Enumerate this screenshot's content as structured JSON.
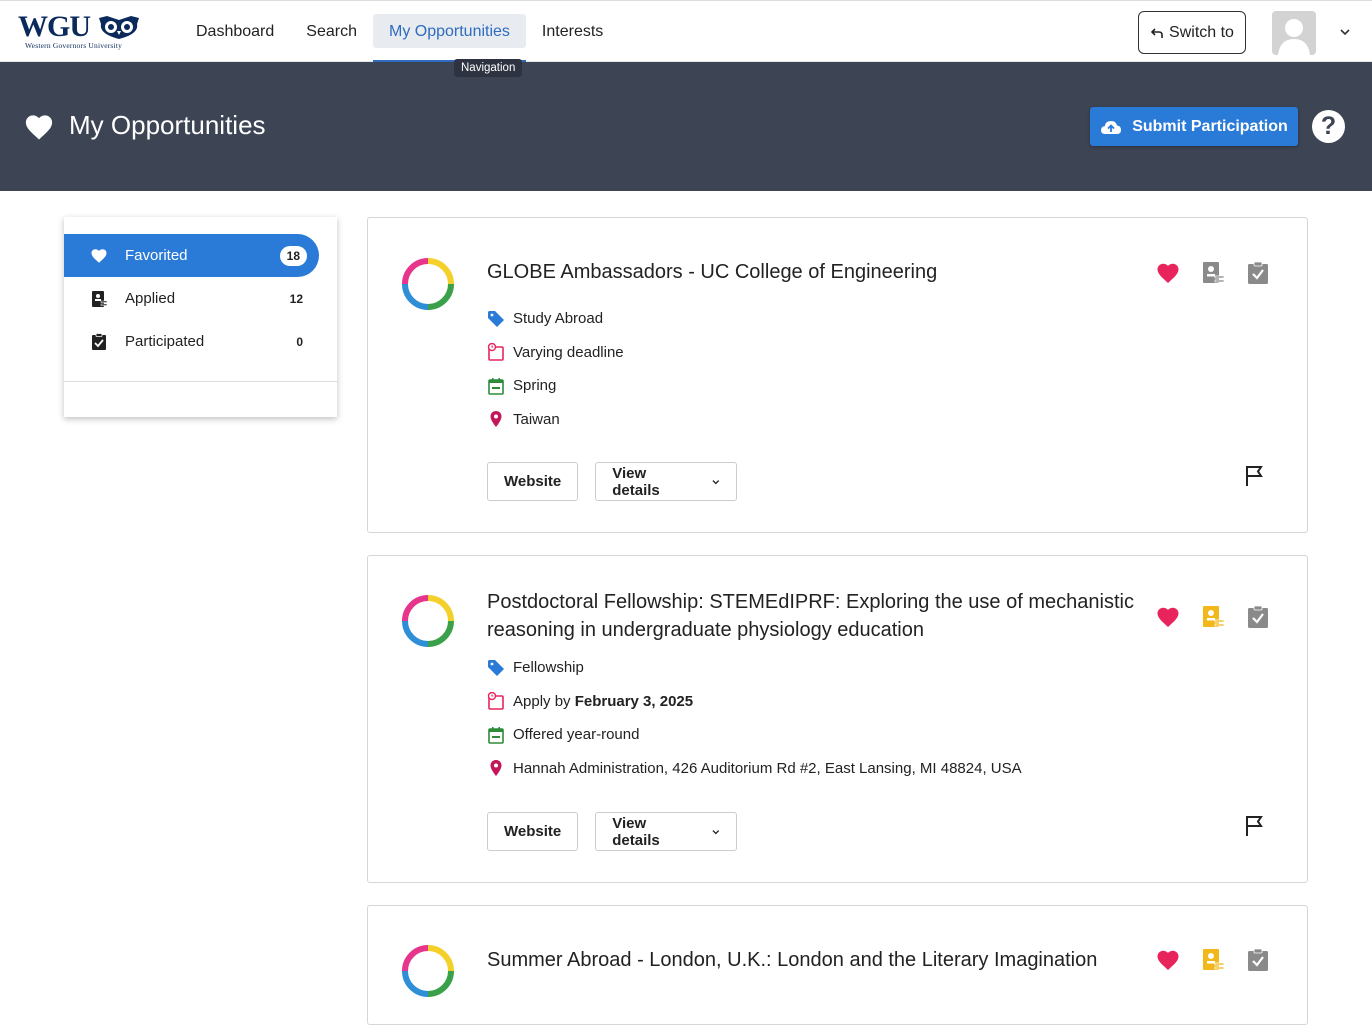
{
  "brand": {
    "logo_text": "WGU",
    "logo_subtitle": "Western Governors University",
    "brand_color": "#0b2a5b"
  },
  "nav": {
    "links": [
      {
        "label": "Dashboard"
      },
      {
        "label": "Search"
      },
      {
        "label": "My Opportunities"
      },
      {
        "label": "Interests"
      }
    ],
    "active": "My Opportunities",
    "tooltip": "Navigation",
    "switch_label": "Switch to"
  },
  "banner": {
    "title": "My Opportunities",
    "submit_label": "Submit Participation",
    "help_label": "?",
    "background": "#3d4454",
    "accent": "#2a7ad8"
  },
  "sidebar": {
    "items": [
      {
        "label": "Favorited",
        "count": "18",
        "icon": "heart-icon",
        "active": true
      },
      {
        "label": "Applied",
        "count": "12",
        "icon": "applied-icon",
        "active": false
      },
      {
        "label": "Participated",
        "count": "0",
        "icon": "clipboard-check-icon",
        "active": false
      }
    ]
  },
  "cards": [
    {
      "title": "GLOBE Ambassadors - UC College of Engineering",
      "type": "Study Abroad",
      "deadline_text": "Varying deadline",
      "deadline_bold": "",
      "term": "Spring",
      "location": "Taiwan",
      "website_label": "Website",
      "details_label": "View details",
      "favorited": true,
      "applied": false,
      "participated": false
    },
    {
      "title": "Postdoctoral Fellowship: STEMEdIPRF: Exploring the use of mechanistic reasoning in undergraduate physiology education",
      "type": "Fellowship",
      "deadline_text": "Apply by ",
      "deadline_bold": "February 3, 2025",
      "term": "Offered year-round",
      "location": "Hannah Administration, 426 Auditorium Rd #2, East Lansing, MI 48824, USA",
      "website_label": "Website",
      "details_label": "View details",
      "favorited": true,
      "applied": true,
      "participated": false
    },
    {
      "title": "Summer Abroad - London, U.K.: London and the Literary Imagination",
      "favorited": true,
      "applied": true,
      "participated": false
    }
  ],
  "colors": {
    "heart": "#e8245c",
    "applied_active": "#f2b81b",
    "inactive_icon": "#8a8a8a",
    "tag": "#2a7ad8",
    "deadline": "#e8245c",
    "term": "#2e8b3a",
    "location": "#c2185b"
  }
}
